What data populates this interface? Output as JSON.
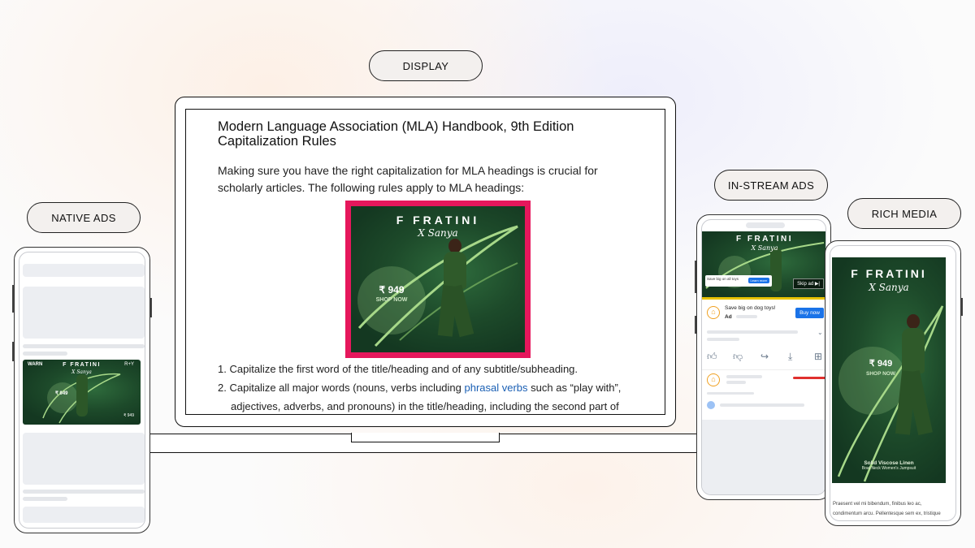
{
  "labels": {
    "display": "DISPLAY",
    "native_ads": "NATIVE ADS",
    "in_stream_ads": "IN-STREAM ADS",
    "rich_media": "RICH MEDIA"
  },
  "laptop_article": {
    "title_line1": "Modern Language Association (MLA) Handbook, 9th Edition",
    "title_line2": "Capitalization Rules",
    "intro": "Making sure you have the right capitalization for MLA headings is crucial for scholarly articles. The following rules apply to MLA headings:",
    "rule1": "Capitalize the first word of the title/heading and of any subtitle/subheading.",
    "rule2_prefix": "Capitalize all major words (nouns, verbs including ",
    "rule2_link": "phrasal verbs",
    "rule2_suffix": " such as “play with”, adjectives, adverbs, and pronouns) in the title/heading, including the second part of",
    "link_color": "#1a5fb4"
  },
  "ad_creative": {
    "brand": "F FRATINI",
    "collab": "X Sanya",
    "price": "₹ 949",
    "cta": "SHOP NOW",
    "frame_color": "#e6175c",
    "ad_color": "#1d4a2a"
  },
  "native_phone": {
    "banner_left_top": "WARN",
    "banner_right_top": "R+Y",
    "banner_left_bottom": "₹ 949",
    "banner_right_bottom": "₹ 949"
  },
  "instream_phone": {
    "skip_label": "Skip ad ▶|",
    "overlay_text": "Save big on all toys",
    "overlay_button": "Learn more",
    "ad_title": "Save big on dog toys!",
    "ad_badge": "Ad",
    "buy_button": "Buy now",
    "accent": "#1a73e8"
  },
  "rich_phone": {
    "product_line1": "Solid Viscose Linen",
    "product_line2": "Boat Neck Women's Jumpsuit",
    "body_line1": "Praesent vel mi bibendum, finibus leo ac,",
    "body_line2": "condimentum arcu. Pellentesque sem ex, tristique"
  }
}
